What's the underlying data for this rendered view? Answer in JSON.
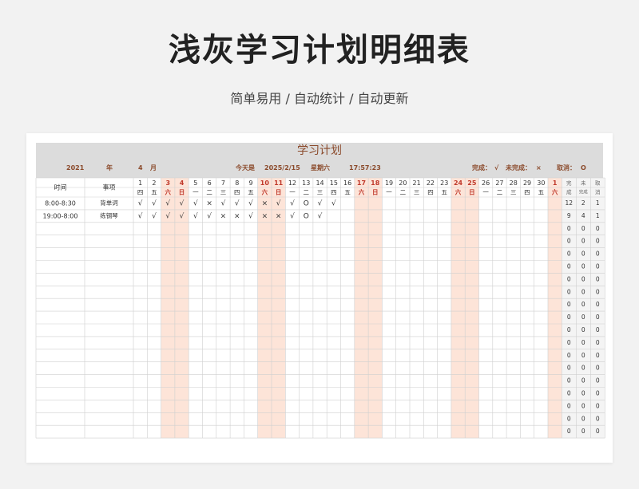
{
  "page": {
    "title": "浅灰学习计划明细表",
    "subtitle": "简单易用 / 自动统计 / 自动更新"
  },
  "plan": {
    "title": "学习计划",
    "info": {
      "year": "2021",
      "year_label": "年",
      "month": "4",
      "month_label": "月",
      "today_label": "今天是",
      "today": "2025/2/15",
      "weekday": "星期六",
      "time": "17:57:23",
      "done_label": "完成：",
      "done_symbol": "√",
      "undone_label": "未完成：",
      "undone_symbol": "×",
      "cancel_label": "取消：",
      "cancel_symbol": "O"
    },
    "headers": {
      "time": "时间",
      "item": "事项",
      "done": "完成",
      "undone": "未完成",
      "cancel": "取消"
    },
    "days": [
      "1",
      "2",
      "3",
      "4",
      "5",
      "6",
      "7",
      "8",
      "9",
      "10",
      "11",
      "12",
      "13",
      "14",
      "15",
      "16",
      "17",
      "18",
      "19",
      "20",
      "21",
      "22",
      "23",
      "24",
      "25",
      "26",
      "27",
      "28",
      "29",
      "30",
      "1"
    ],
    "weekdays": [
      "四",
      "五",
      "六",
      "日",
      "一",
      "二",
      "三",
      "四",
      "五",
      "六",
      "日",
      "一",
      "二",
      "三",
      "四",
      "五",
      "六",
      "日",
      "一",
      "二",
      "三",
      "四",
      "五",
      "六",
      "日",
      "一",
      "二",
      "三",
      "四",
      "五",
      "六"
    ],
    "rows": [
      {
        "time": "8:00-8:30",
        "item": "背单词",
        "marks": [
          "√",
          "√",
          "√",
          "√",
          "√",
          "×",
          "√",
          "√",
          "√",
          "×",
          "√",
          "√",
          "O",
          "√",
          "√",
          "",
          "",
          "",
          "",
          "",
          "",
          "",
          "",
          "",
          "",
          "",
          "",
          "",
          "",
          "",
          ""
        ],
        "done": "12",
        "undone": "2",
        "cancel": "1"
      },
      {
        "time": "19:00-8:00",
        "item": "练钢琴",
        "marks": [
          "√",
          "√",
          "√",
          "√",
          "√",
          "√",
          "×",
          "×",
          "√",
          "×",
          "×",
          "√",
          "O",
          "√",
          "",
          "",
          "",
          "",
          "",
          "",
          "",
          "",
          "",
          "",
          "",
          "",
          "",
          "",
          "",
          "",
          ""
        ],
        "done": "9",
        "undone": "4",
        "cancel": "1"
      }
    ],
    "empty_row_count": 17,
    "empty_row_stat": "0",
    "colors": {
      "weekend_bg": "#fde4d8",
      "weekend_text": "#c0392b",
      "accent": "#8b4a2b"
    }
  }
}
